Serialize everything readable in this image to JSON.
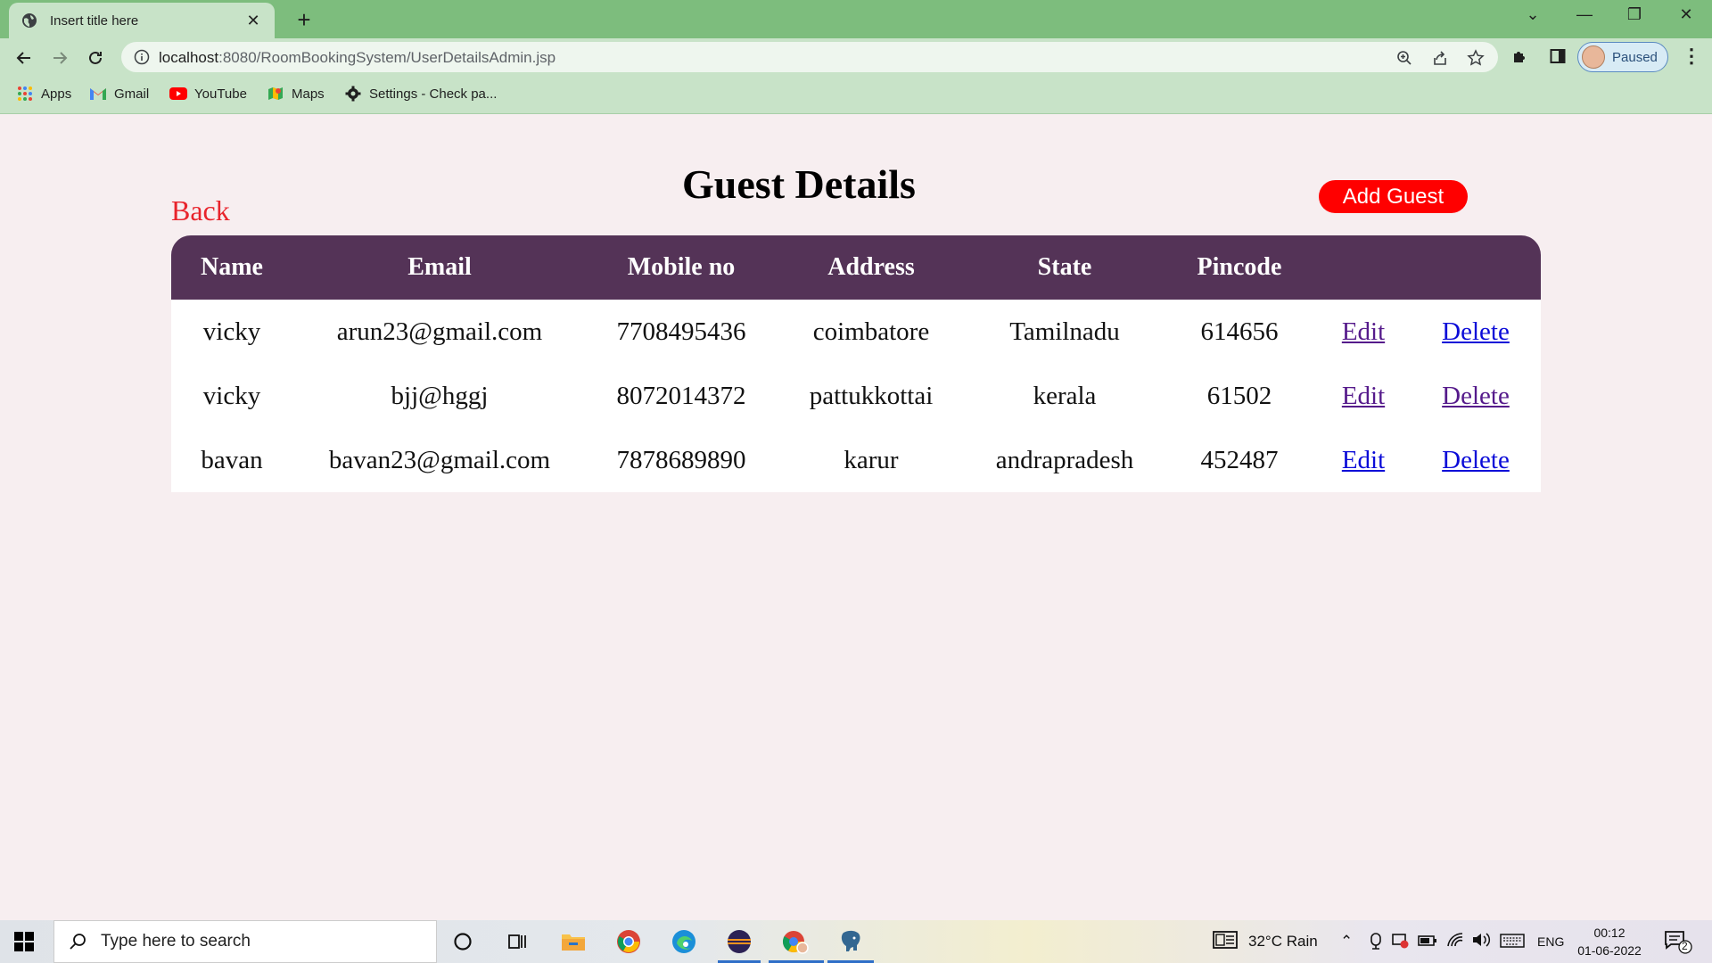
{
  "browser": {
    "tab_title": "Insert title here",
    "url_host": "localhost",
    "url_rest": ":8080/RoomBookingSystem/UserDetailsAdmin.jsp",
    "profile_label": "Paused",
    "bookmarks": [
      "Apps",
      "Gmail",
      "YouTube",
      "Maps",
      "Settings - Check pa..."
    ]
  },
  "page": {
    "title": "Guest Details",
    "back_label": "Back",
    "add_guest_label": "Add Guest",
    "colors": {
      "header_bg": "#543357",
      "back": "#e8242c",
      "add_button": "#ff0000",
      "page_bg": "#f7eef0"
    },
    "table": {
      "headers": [
        "Name",
        "Email",
        "Mobile no",
        "Address",
        "State",
        "Pincode",
        "",
        ""
      ],
      "edit_label": "Edit",
      "delete_label": "Delete",
      "rows": [
        {
          "name": "vicky",
          "email": "arun23@gmail.com",
          "mobile": "7708495436",
          "address": "coimbatore",
          "state": "Tamilnadu",
          "pincode": "614656"
        },
        {
          "name": "vicky",
          "email": "bjj@hggj",
          "mobile": "8072014372",
          "address": "pattukkottai",
          "state": "kerala",
          "pincode": "61502"
        },
        {
          "name": "bavan",
          "email": "bavan23@gmail.com",
          "mobile": "7878689890",
          "address": "karur",
          "state": "andrapradesh",
          "pincode": "452487"
        }
      ]
    }
  },
  "taskbar": {
    "search_placeholder": "Type here to search",
    "weather": "32°C  Rain",
    "language": "ENG",
    "time": "00:12",
    "date": "01-06-2022",
    "notification_count": "2"
  }
}
